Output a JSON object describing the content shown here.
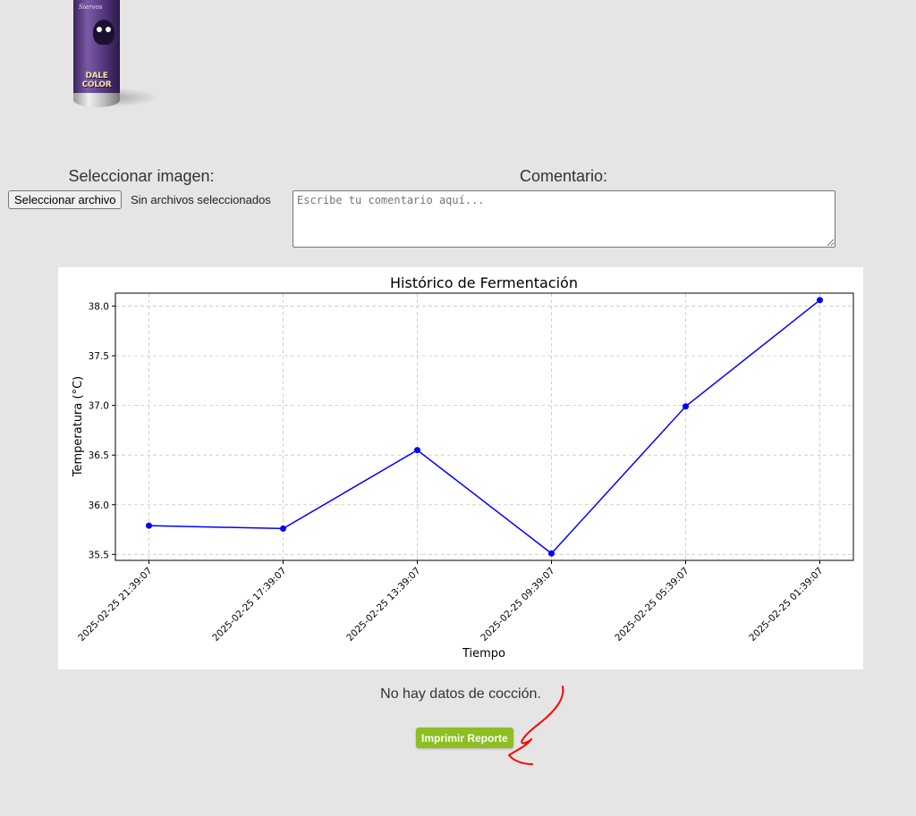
{
  "product_image": {
    "brand_text": "Siervos",
    "label_text": "DALE COLOR"
  },
  "upload": {
    "label": "Seleccionar imagen:",
    "button_label": "Seleccionar archivo",
    "status": "Sin archivos seleccionados"
  },
  "comment": {
    "label": "Comentario:",
    "placeholder": "Escribe tu comentario aquí...",
    "value": ""
  },
  "chart_data": {
    "type": "line",
    "title": "Histórico de Fermentación",
    "xlabel": "Tiempo",
    "ylabel": "Temperatura (°C)",
    "categories": [
      "2025-02-25 21:39:07",
      "2025-02-25 17:39:07",
      "2025-02-25 13:39:07",
      "2025-02-25 09:39:07",
      "2025-02-25 05:39:07",
      "2025-02-25 01:39:07"
    ],
    "values": [
      35.79,
      35.76,
      36.55,
      35.51,
      36.99,
      38.06
    ],
    "yticks": [
      "35.5",
      "36.0",
      "36.5",
      "37.0",
      "37.5",
      "38.0"
    ],
    "ylim": [
      35.44,
      38.13
    ],
    "grid": true,
    "line_color": "#0000ff",
    "marker": "circle"
  },
  "cooking": {
    "message": "No hay datos de cocción."
  },
  "actions": {
    "print_label": "Imprimir Reporte",
    "print_color": "#8cbf1f"
  },
  "annotation": {
    "color": "#ff0000",
    "shape": "hand-drawn-arrow"
  }
}
